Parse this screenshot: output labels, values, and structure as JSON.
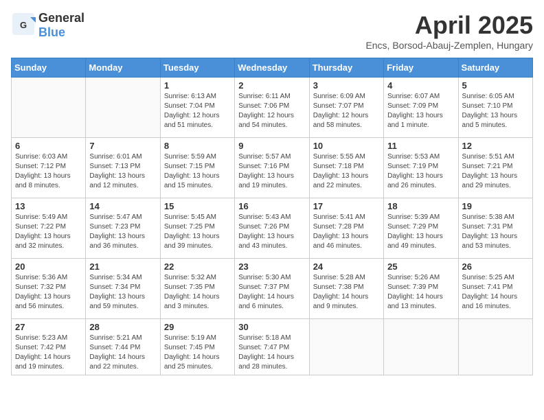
{
  "header": {
    "logo_general": "General",
    "logo_blue": "Blue",
    "title": "April 2025",
    "subtitle": "Encs, Borsod-Abauj-Zemplen, Hungary"
  },
  "weekdays": [
    "Sunday",
    "Monday",
    "Tuesday",
    "Wednesday",
    "Thursday",
    "Friday",
    "Saturday"
  ],
  "weeks": [
    [
      {
        "day": "",
        "info": ""
      },
      {
        "day": "",
        "info": ""
      },
      {
        "day": "1",
        "info": "Sunrise: 6:13 AM\nSunset: 7:04 PM\nDaylight: 12 hours and 51 minutes."
      },
      {
        "day": "2",
        "info": "Sunrise: 6:11 AM\nSunset: 7:06 PM\nDaylight: 12 hours and 54 minutes."
      },
      {
        "day": "3",
        "info": "Sunrise: 6:09 AM\nSunset: 7:07 PM\nDaylight: 12 hours and 58 minutes."
      },
      {
        "day": "4",
        "info": "Sunrise: 6:07 AM\nSunset: 7:09 PM\nDaylight: 13 hours and 1 minute."
      },
      {
        "day": "5",
        "info": "Sunrise: 6:05 AM\nSunset: 7:10 PM\nDaylight: 13 hours and 5 minutes."
      }
    ],
    [
      {
        "day": "6",
        "info": "Sunrise: 6:03 AM\nSunset: 7:12 PM\nDaylight: 13 hours and 8 minutes."
      },
      {
        "day": "7",
        "info": "Sunrise: 6:01 AM\nSunset: 7:13 PM\nDaylight: 13 hours and 12 minutes."
      },
      {
        "day": "8",
        "info": "Sunrise: 5:59 AM\nSunset: 7:15 PM\nDaylight: 13 hours and 15 minutes."
      },
      {
        "day": "9",
        "info": "Sunrise: 5:57 AM\nSunset: 7:16 PM\nDaylight: 13 hours and 19 minutes."
      },
      {
        "day": "10",
        "info": "Sunrise: 5:55 AM\nSunset: 7:18 PM\nDaylight: 13 hours and 22 minutes."
      },
      {
        "day": "11",
        "info": "Sunrise: 5:53 AM\nSunset: 7:19 PM\nDaylight: 13 hours and 26 minutes."
      },
      {
        "day": "12",
        "info": "Sunrise: 5:51 AM\nSunset: 7:21 PM\nDaylight: 13 hours and 29 minutes."
      }
    ],
    [
      {
        "day": "13",
        "info": "Sunrise: 5:49 AM\nSunset: 7:22 PM\nDaylight: 13 hours and 32 minutes."
      },
      {
        "day": "14",
        "info": "Sunrise: 5:47 AM\nSunset: 7:23 PM\nDaylight: 13 hours and 36 minutes."
      },
      {
        "day": "15",
        "info": "Sunrise: 5:45 AM\nSunset: 7:25 PM\nDaylight: 13 hours and 39 minutes."
      },
      {
        "day": "16",
        "info": "Sunrise: 5:43 AM\nSunset: 7:26 PM\nDaylight: 13 hours and 43 minutes."
      },
      {
        "day": "17",
        "info": "Sunrise: 5:41 AM\nSunset: 7:28 PM\nDaylight: 13 hours and 46 minutes."
      },
      {
        "day": "18",
        "info": "Sunrise: 5:39 AM\nSunset: 7:29 PM\nDaylight: 13 hours and 49 minutes."
      },
      {
        "day": "19",
        "info": "Sunrise: 5:38 AM\nSunset: 7:31 PM\nDaylight: 13 hours and 53 minutes."
      }
    ],
    [
      {
        "day": "20",
        "info": "Sunrise: 5:36 AM\nSunset: 7:32 PM\nDaylight: 13 hours and 56 minutes."
      },
      {
        "day": "21",
        "info": "Sunrise: 5:34 AM\nSunset: 7:34 PM\nDaylight: 13 hours and 59 minutes."
      },
      {
        "day": "22",
        "info": "Sunrise: 5:32 AM\nSunset: 7:35 PM\nDaylight: 14 hours and 3 minutes."
      },
      {
        "day": "23",
        "info": "Sunrise: 5:30 AM\nSunset: 7:37 PM\nDaylight: 14 hours and 6 minutes."
      },
      {
        "day": "24",
        "info": "Sunrise: 5:28 AM\nSunset: 7:38 PM\nDaylight: 14 hours and 9 minutes."
      },
      {
        "day": "25",
        "info": "Sunrise: 5:26 AM\nSunset: 7:39 PM\nDaylight: 14 hours and 13 minutes."
      },
      {
        "day": "26",
        "info": "Sunrise: 5:25 AM\nSunset: 7:41 PM\nDaylight: 14 hours and 16 minutes."
      }
    ],
    [
      {
        "day": "27",
        "info": "Sunrise: 5:23 AM\nSunset: 7:42 PM\nDaylight: 14 hours and 19 minutes."
      },
      {
        "day": "28",
        "info": "Sunrise: 5:21 AM\nSunset: 7:44 PM\nDaylight: 14 hours and 22 minutes."
      },
      {
        "day": "29",
        "info": "Sunrise: 5:19 AM\nSunset: 7:45 PM\nDaylight: 14 hours and 25 minutes."
      },
      {
        "day": "30",
        "info": "Sunrise: 5:18 AM\nSunset: 7:47 PM\nDaylight: 14 hours and 28 minutes."
      },
      {
        "day": "",
        "info": ""
      },
      {
        "day": "",
        "info": ""
      },
      {
        "day": "",
        "info": ""
      }
    ]
  ]
}
